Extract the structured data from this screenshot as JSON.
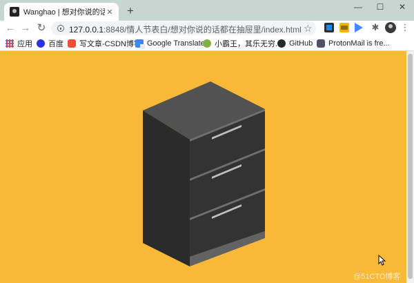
{
  "browser": {
    "tab": {
      "title": "Wanghao | 想对你说的话都在抽屉里",
      "close": "✕"
    },
    "new_tab": "+",
    "window_controls": {
      "minimize": "—",
      "maximize": "☐",
      "close": "✕"
    },
    "nav": {
      "back": "←",
      "forward": "→",
      "reload": "↻"
    },
    "address": {
      "host": "127.0.0.1",
      "path": ":8848/情人节表白/想对你说的话都在抽屉里/index.html"
    },
    "bookmark_star": "☆",
    "extension_puzzle": "✱",
    "menu": "⋮",
    "bookmarks": [
      {
        "label": "应用",
        "icon": "apps-grid-icon"
      },
      {
        "label": "百度",
        "icon": "baidu-icon"
      },
      {
        "label": "写文章-CSDN博客",
        "icon": "csdn-icon"
      },
      {
        "label": "Google Translate",
        "icon": "google-translate-icon"
      },
      {
        "label": "小霸王，其乐无穷...",
        "icon": "xiaobawang-icon"
      },
      {
        "label": "GitHub",
        "icon": "github-icon"
      },
      {
        "label": "ProtonMail is fre...",
        "icon": "protonmail-icon"
      }
    ]
  },
  "page": {
    "background_color": "#f9b938",
    "cabinet": {
      "drawers": 3,
      "colors": {
        "top": "#505050",
        "left": "#2b2b2b",
        "front": "#333333",
        "edge": "#6f6f6f",
        "base": "#626262",
        "handle": "#bfbfbf"
      }
    }
  },
  "watermark": "@51CTO博客"
}
